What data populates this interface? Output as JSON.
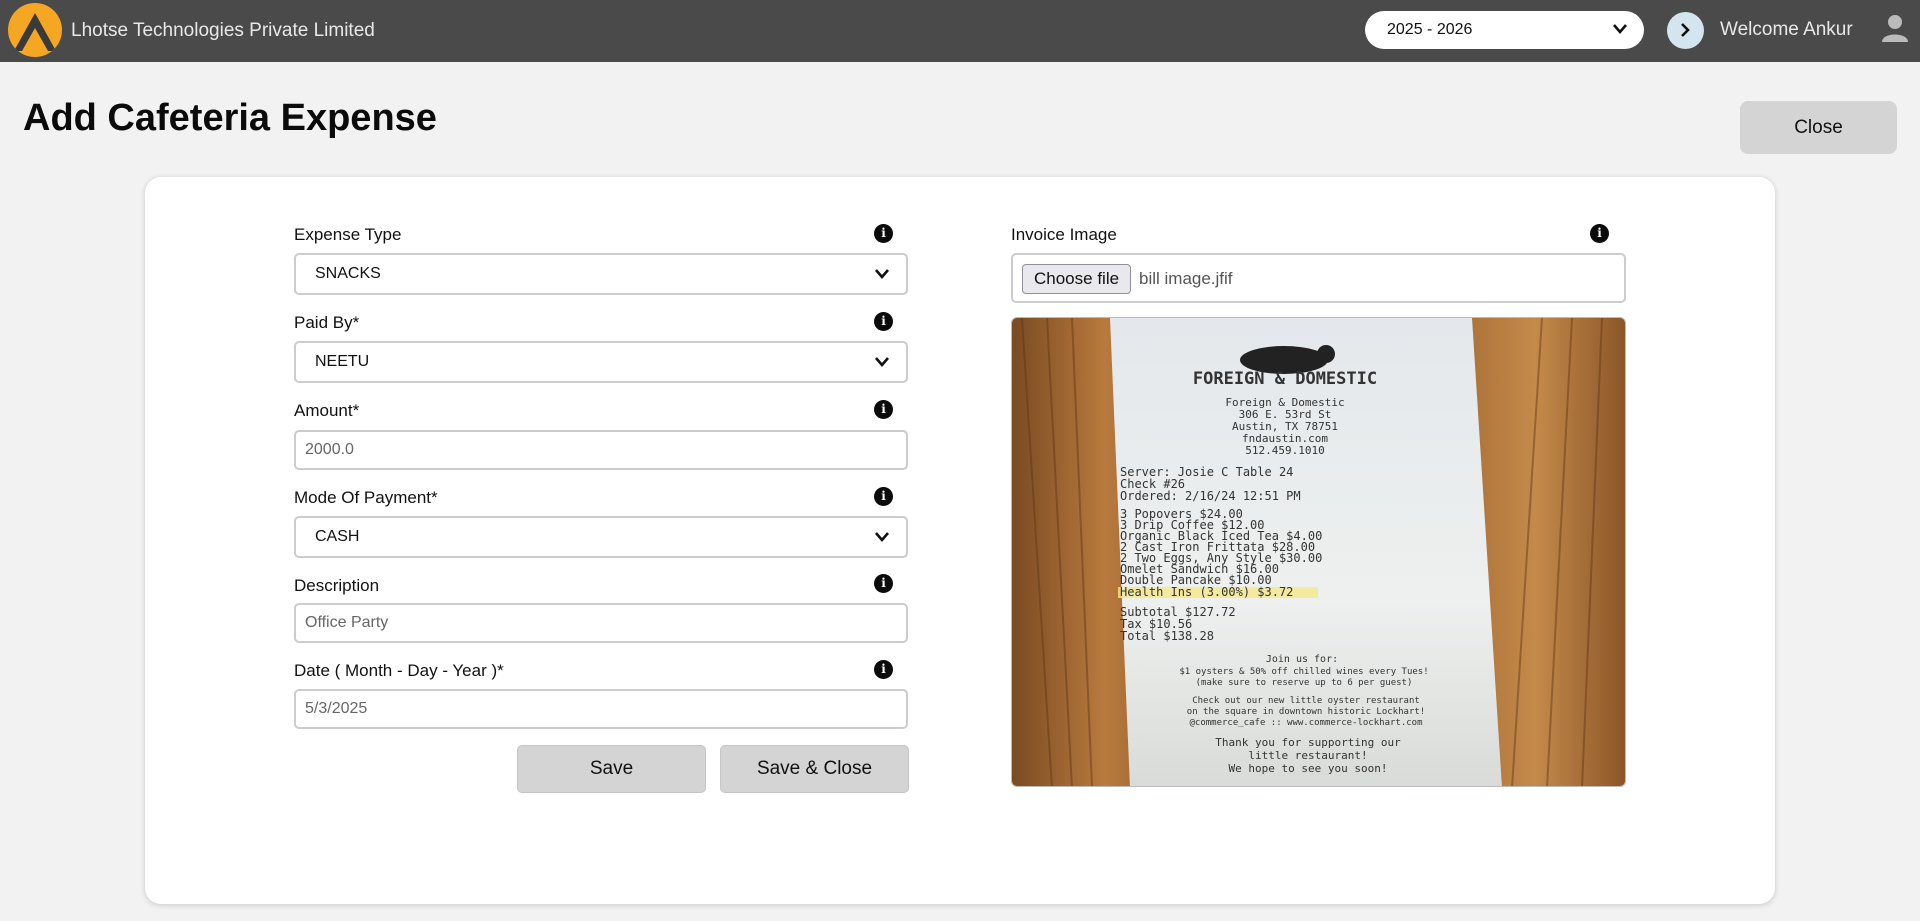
{
  "header": {
    "company": "Lhotse Technologies Private Limited",
    "year": "2025 - 2026",
    "welcome": "Welcome Ankur",
    "icons": {
      "logo": "mountain-logo",
      "year_dropdown": "chevron-down-icon",
      "next": "chevron-right-icon",
      "user": "user-icon"
    }
  },
  "page": {
    "title": "Add Cafeteria Expense",
    "close_label": "Close"
  },
  "form": {
    "expense_type": {
      "label": "Expense Type",
      "value": "SNACKS"
    },
    "paid_by": {
      "label": "Paid By",
      "required_mark": "*",
      "value": "NEETU"
    },
    "amount": {
      "label": "Amount",
      "required_mark": "*",
      "value": "2000.0"
    },
    "mode_of_payment": {
      "label": "Mode Of Payment",
      "required_mark": "*",
      "value": "CASH"
    },
    "description": {
      "label": "Description",
      "value": "Office Party"
    },
    "date": {
      "label": "Date ( Month - Day - Year )",
      "required_mark": "*",
      "value": "5/3/2025"
    },
    "save_label": "Save",
    "save_close_label": "Save & Close"
  },
  "invoice": {
    "label": "Invoice Image",
    "choose_label": "Choose file",
    "file_name": "bill image.jfif",
    "receipt": {
      "store": "FOREIGN & DOMESTIC",
      "lines": [
        "Foreign & Domestic",
        "306 E. 53rd St",
        "Austin, TX 78751",
        "fndaustin.com",
        "512.459.1010",
        "Server: Josie C      Table 24",
        "Check #26",
        "Ordered:     2/16/24 12:51 PM",
        "3 Popovers            $24.00",
        "3 Drip Coffee         $12.00",
        "Organic Black Iced Tea $4.00",
        "2 Cast Iron Frittata  $28.00",
        "2 Two Eggs, Any Style $30.00",
        "Omelet Sandwich       $16.00",
        "Double Pancake        $10.00",
        "Health Ins (3.00%)     $3.72",
        "Subtotal             $127.72",
        "Tax                   $10.56",
        "Total                $138.28",
        "Join us for:",
        "$1 oysters & 50% off chilled wines every Tues!",
        "(make sure to reserve up to 6 per guest)",
        "Check out our new little oyster restaurant",
        "on the square in downtown historic Lockhart!",
        "@commerce_cafe :: www.commerce-lockhart.com",
        "Thank you for supporting our",
        "little restaurant!",
        "We hope to see you soon!"
      ]
    }
  },
  "colors": {
    "topbar": "#4a4a4a",
    "logo": "#f5a623",
    "page_bg": "#f3f2f2",
    "button": "#d4d4d4"
  }
}
